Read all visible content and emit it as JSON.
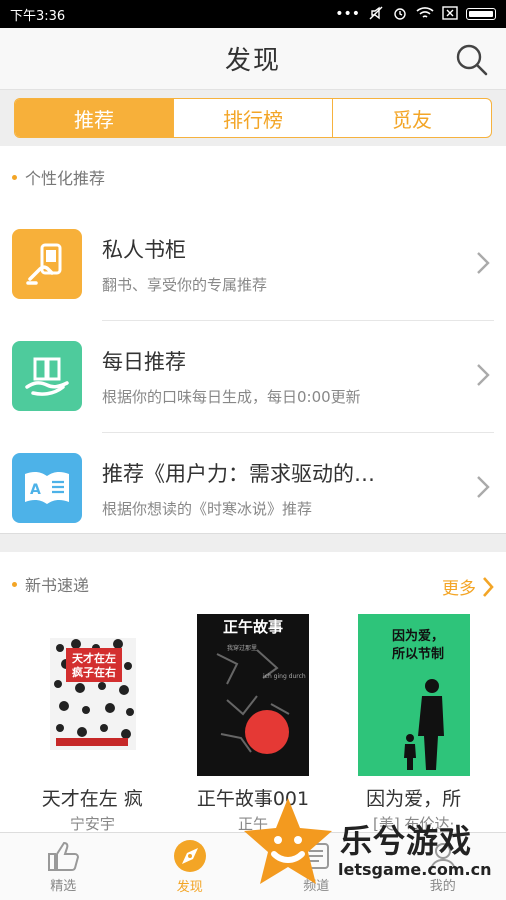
{
  "status": {
    "time": "下午3:36",
    "dots": "•••"
  },
  "header": {
    "title": "发现"
  },
  "tabs": [
    {
      "label": "推荐",
      "active": true
    },
    {
      "label": "排行榜",
      "active": false
    },
    {
      "label": "觅友",
      "active": false
    }
  ],
  "personal": {
    "heading": "个性化推荐",
    "items": [
      {
        "title": "私人书柜",
        "subtitle": "翻书、享受你的专属推荐",
        "icon": "hand-phone-icon",
        "color": "#f7b03a"
      },
      {
        "title": "每日推荐",
        "subtitle": "根据你的口味每日生成，每日0:00更新",
        "icon": "hand-book-icon",
        "color": "#4ecb9c"
      },
      {
        "title": "推荐《用户力：需求驱动的…",
        "subtitle": "根据你想读的《时寒冰说》推荐",
        "icon": "open-book-icon",
        "color": "#4db2e8"
      }
    ]
  },
  "newbooks": {
    "heading": "新书速递",
    "more": "更多",
    "items": [
      {
        "title": "天才在左  疯",
        "author": "宁安宇",
        "cover_text": "天才在左 疯子在右"
      },
      {
        "title": "正午故事001",
        "author": "正午",
        "cover_text": "正午故事"
      },
      {
        "title": "因为爱，所",
        "author": "[美] 布伦达·",
        "cover_text": "因为爱，所以节制"
      }
    ]
  },
  "nav": [
    {
      "label": "精选",
      "icon": "thumbs-up-icon",
      "active": false
    },
    {
      "label": "发现",
      "icon": "compass-icon",
      "active": true
    },
    {
      "label": "频道",
      "icon": "channel-icon",
      "active": false
    },
    {
      "label": "我的",
      "icon": "user-icon",
      "active": false
    }
  ],
  "watermark": {
    "name": "乐兮游戏",
    "url": "letsgame.com.cn"
  },
  "colors": {
    "accent": "#f3a526",
    "tab_active": "#f7b03a"
  }
}
